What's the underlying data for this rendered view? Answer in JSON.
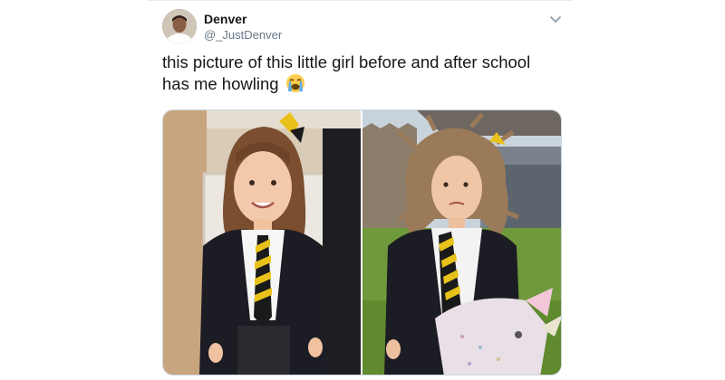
{
  "tweet": {
    "display_name": "Denver",
    "handle": "@_JustDenver",
    "text": "this picture of this little girl before and after school has me howling",
    "emoji": "loudly-crying-face",
    "menu_icon": "chevron-down-icon"
  },
  "media": {
    "photos": [
      {
        "subject": "girl-before-school-photo"
      },
      {
        "subject": "girl-after-school-photo"
      }
    ]
  },
  "colors": {
    "text": "#14171a",
    "secondary": "#657786",
    "tie_yellow": "#e8c21a",
    "tie_black": "#1a1a1a",
    "blazer": "#1c1c24"
  }
}
